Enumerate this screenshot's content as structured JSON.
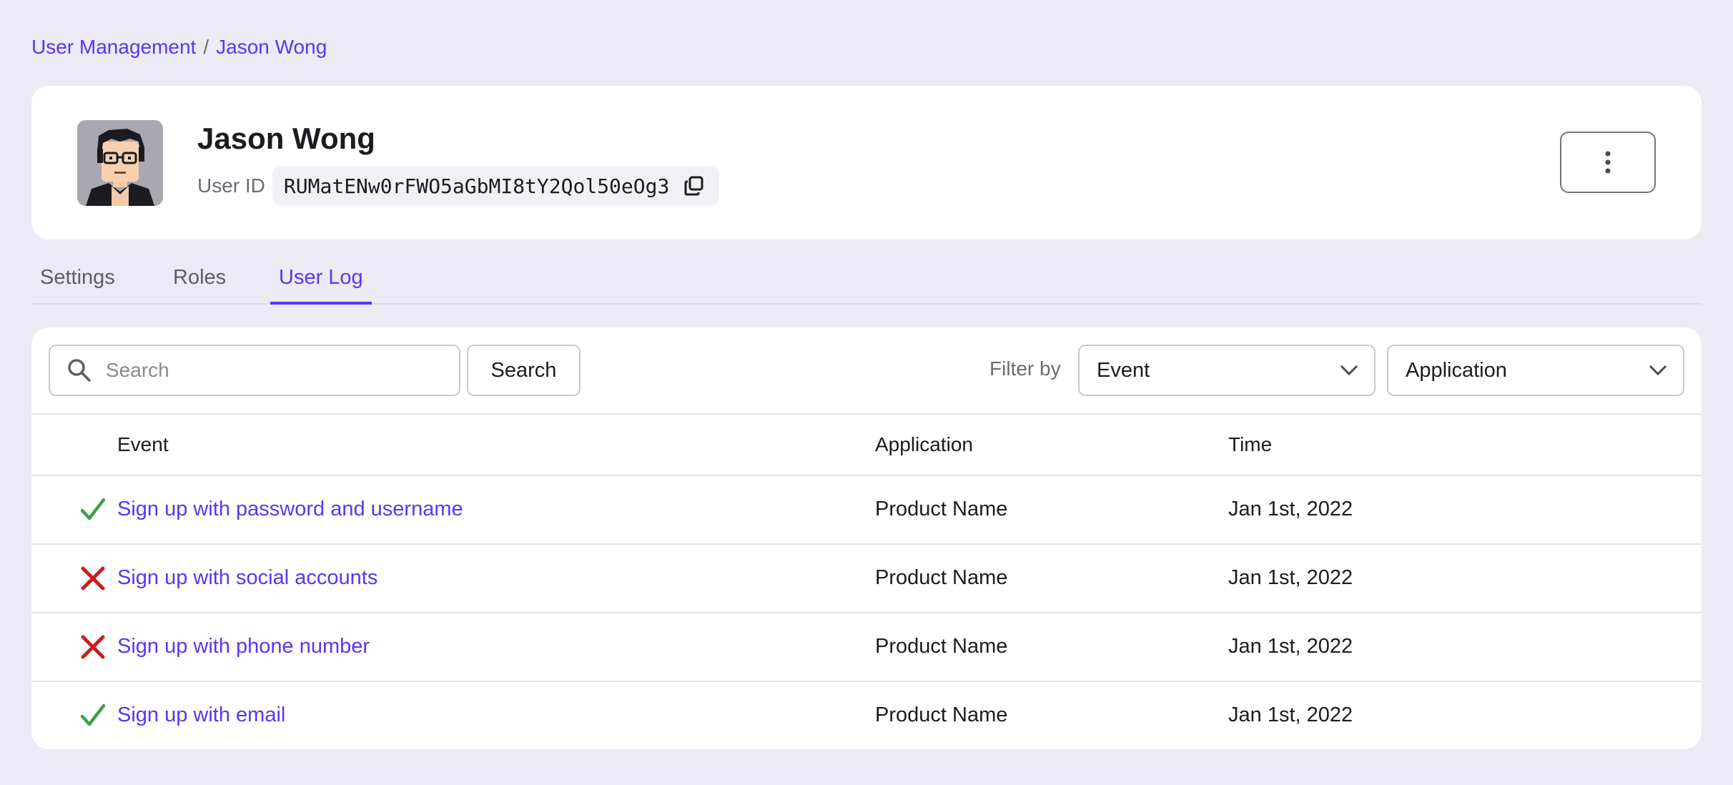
{
  "breadcrumb": {
    "parent": "User Management",
    "separator": "/",
    "current": "Jason Wong"
  },
  "user": {
    "name": "Jason Wong",
    "id_label": "User ID",
    "id_value": "RUMatENw0rFWO5aGbMI8tY2Qol50eOg3"
  },
  "tabs": [
    {
      "label": "Settings",
      "active": false
    },
    {
      "label": "Roles",
      "active": false
    },
    {
      "label": "User Log",
      "active": true
    }
  ],
  "toolbar": {
    "search_placeholder": "Search",
    "search_button": "Search",
    "filter_label": "Filter by",
    "event_select": "Event",
    "application_select": "Application"
  },
  "table": {
    "columns": {
      "event": "Event",
      "application": "Application",
      "time": "Time"
    },
    "rows": [
      {
        "status": "success",
        "event": "Sign up with password and username",
        "application": "Product Name",
        "time": "Jan 1st, 2022"
      },
      {
        "status": "failure",
        "event": "Sign up with social accounts",
        "application": "Product Name",
        "time": "Jan 1st, 2022"
      },
      {
        "status": "failure",
        "event": "Sign up with phone number",
        "application": "Product Name",
        "time": "Jan 1st, 2022"
      },
      {
        "status": "success",
        "event": "Sign up with email",
        "application": "Product Name",
        "time": "Jan 1st, 2022"
      }
    ]
  },
  "colors": {
    "accent": "#5d34f2",
    "background": "#eceaf5",
    "success": "#3f9f4a",
    "failure": "#c81e1e"
  },
  "icons": {
    "search": "search-icon",
    "copy": "copy-icon",
    "more": "more-vertical-icon",
    "dropdown": "chevron-down-icon",
    "success": "check-icon",
    "failure": "cross-icon"
  }
}
